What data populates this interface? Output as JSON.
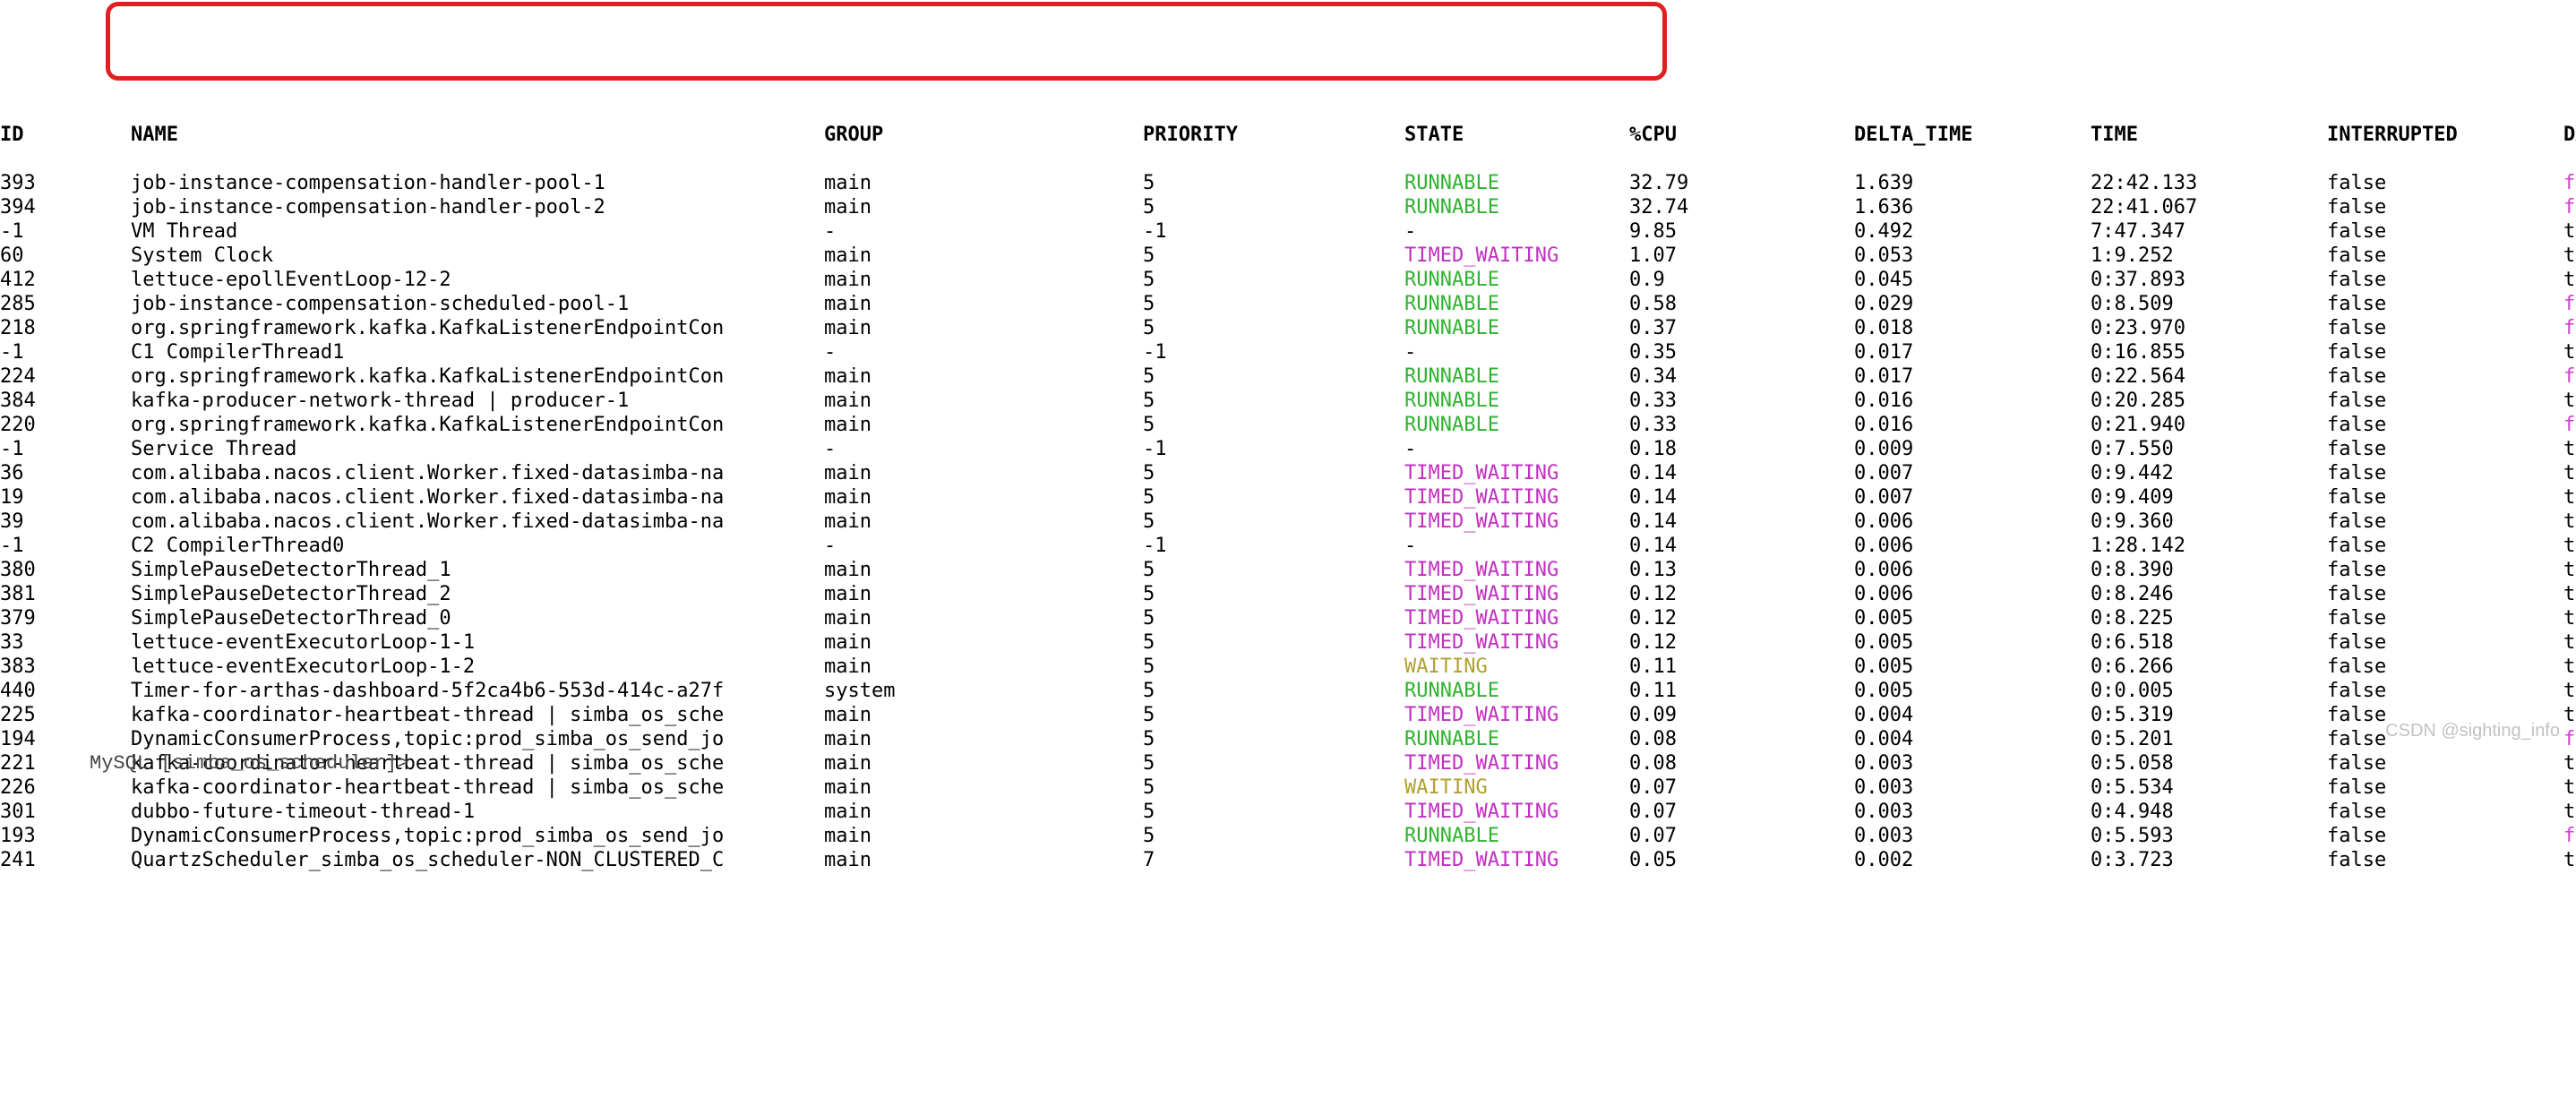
{
  "headers": {
    "id": "ID",
    "name": "NAME",
    "group": "GROUP",
    "priority": "PRIORITY",
    "state": "STATE",
    "cpu": "%CPU",
    "delta": "DELTA_TIME",
    "time": "TIME",
    "interrupted": "INTERRUPTED",
    "daemon": "DAEMON"
  },
  "rows": [
    {
      "id": "393",
      "name": "job-instance-compensation-handler-pool-1",
      "group": "main",
      "priority": "5",
      "state": "RUNNABLE",
      "cpu": "32.79",
      "delta": "1.639",
      "time": "22:42.133",
      "interrupted": "false",
      "daemon": "false"
    },
    {
      "id": "394",
      "name": "job-instance-compensation-handler-pool-2",
      "group": "main",
      "priority": "5",
      "state": "RUNNABLE",
      "cpu": "32.74",
      "delta": "1.636",
      "time": "22:41.067",
      "interrupted": "false",
      "daemon": "false"
    },
    {
      "id": "-1",
      "name": "VM Thread",
      "group": "-",
      "priority": "-1",
      "state": "-",
      "cpu": "9.85",
      "delta": "0.492",
      "time": "7:47.347",
      "interrupted": "false",
      "daemon": "true"
    },
    {
      "id": "60",
      "name": "System Clock",
      "group": "main",
      "priority": "5",
      "state": "TIMED_WAITING",
      "cpu": "1.07",
      "delta": "0.053",
      "time": "1:9.252",
      "interrupted": "false",
      "daemon": "true"
    },
    {
      "id": "412",
      "name": "lettuce-epollEventLoop-12-2",
      "group": "main",
      "priority": "5",
      "state": "RUNNABLE",
      "cpu": "0.9",
      "delta": "0.045",
      "time": "0:37.893",
      "interrupted": "false",
      "daemon": "true"
    },
    {
      "id": "285",
      "name": "job-instance-compensation-scheduled-pool-1",
      "group": "main",
      "priority": "5",
      "state": "RUNNABLE",
      "cpu": "0.58",
      "delta": "0.029",
      "time": "0:8.509",
      "interrupted": "false",
      "daemon": "false"
    },
    {
      "id": "218",
      "name": "org.springframework.kafka.KafkaListenerEndpointCon",
      "group": "main",
      "priority": "5",
      "state": "RUNNABLE",
      "cpu": "0.37",
      "delta": "0.018",
      "time": "0:23.970",
      "interrupted": "false",
      "daemon": "false"
    },
    {
      "id": "-1",
      "name": "C1 CompilerThread1",
      "group": "-",
      "priority": "-1",
      "state": "-",
      "cpu": "0.35",
      "delta": "0.017",
      "time": "0:16.855",
      "interrupted": "false",
      "daemon": "true"
    },
    {
      "id": "224",
      "name": "org.springframework.kafka.KafkaListenerEndpointCon",
      "group": "main",
      "priority": "5",
      "state": "RUNNABLE",
      "cpu": "0.34",
      "delta": "0.017",
      "time": "0:22.564",
      "interrupted": "false",
      "daemon": "false"
    },
    {
      "id": "384",
      "name": "kafka-producer-network-thread | producer-1",
      "group": "main",
      "priority": "5",
      "state": "RUNNABLE",
      "cpu": "0.33",
      "delta": "0.016",
      "time": "0:20.285",
      "interrupted": "false",
      "daemon": "true"
    },
    {
      "id": "220",
      "name": "org.springframework.kafka.KafkaListenerEndpointCon",
      "group": "main",
      "priority": "5",
      "state": "RUNNABLE",
      "cpu": "0.33",
      "delta": "0.016",
      "time": "0:21.940",
      "interrupted": "false",
      "daemon": "false"
    },
    {
      "id": "-1",
      "name": "Service Thread",
      "group": "-",
      "priority": "-1",
      "state": "-",
      "cpu": "0.18",
      "delta": "0.009",
      "time": "0:7.550",
      "interrupted": "false",
      "daemon": "true"
    },
    {
      "id": "36",
      "name": "com.alibaba.nacos.client.Worker.fixed-datasimba-na",
      "group": "main",
      "priority": "5",
      "state": "TIMED_WAITING",
      "cpu": "0.14",
      "delta": "0.007",
      "time": "0:9.442",
      "interrupted": "false",
      "daemon": "true"
    },
    {
      "id": "19",
      "name": "com.alibaba.nacos.client.Worker.fixed-datasimba-na",
      "group": "main",
      "priority": "5",
      "state": "TIMED_WAITING",
      "cpu": "0.14",
      "delta": "0.007",
      "time": "0:9.409",
      "interrupted": "false",
      "daemon": "true"
    },
    {
      "id": "39",
      "name": "com.alibaba.nacos.client.Worker.fixed-datasimba-na",
      "group": "main",
      "priority": "5",
      "state": "TIMED_WAITING",
      "cpu": "0.14",
      "delta": "0.006",
      "time": "0:9.360",
      "interrupted": "false",
      "daemon": "true"
    },
    {
      "id": "-1",
      "name": "C2 CompilerThread0",
      "group": "-",
      "priority": "-1",
      "state": "-",
      "cpu": "0.14",
      "delta": "0.006",
      "time": "1:28.142",
      "interrupted": "false",
      "daemon": "true"
    },
    {
      "id": "380",
      "name": "SimplePauseDetectorThread_1",
      "group": "main",
      "priority": "5",
      "state": "TIMED_WAITING",
      "cpu": "0.13",
      "delta": "0.006",
      "time": "0:8.390",
      "interrupted": "false",
      "daemon": "true"
    },
    {
      "id": "381",
      "name": "SimplePauseDetectorThread_2",
      "group": "main",
      "priority": "5",
      "state": "TIMED_WAITING",
      "cpu": "0.12",
      "delta": "0.006",
      "time": "0:8.246",
      "interrupted": "false",
      "daemon": "true"
    },
    {
      "id": "379",
      "name": "SimplePauseDetectorThread_0",
      "group": "main",
      "priority": "5",
      "state": "TIMED_WAITING",
      "cpu": "0.12",
      "delta": "0.005",
      "time": "0:8.225",
      "interrupted": "false",
      "daemon": "true"
    },
    {
      "id": "33",
      "name": "lettuce-eventExecutorLoop-1-1",
      "group": "main",
      "priority": "5",
      "state": "TIMED_WAITING",
      "cpu": "0.12",
      "delta": "0.005",
      "time": "0:6.518",
      "interrupted": "false",
      "daemon": "true"
    },
    {
      "id": "383",
      "name": "lettuce-eventExecutorLoop-1-2",
      "group": "main",
      "priority": "5",
      "state": "WAITING",
      "cpu": "0.11",
      "delta": "0.005",
      "time": "0:6.266",
      "interrupted": "false",
      "daemon": "true"
    },
    {
      "id": "440",
      "name": "Timer-for-arthas-dashboard-5f2ca4b6-553d-414c-a27f",
      "group": "system",
      "priority": "5",
      "state": "RUNNABLE",
      "cpu": "0.11",
      "delta": "0.005",
      "time": "0:0.005",
      "interrupted": "false",
      "daemon": "true"
    },
    {
      "id": "225",
      "name": "kafka-coordinator-heartbeat-thread | simba_os_sche",
      "group": "main",
      "priority": "5",
      "state": "TIMED_WAITING",
      "cpu": "0.09",
      "delta": "0.004",
      "time": "0:5.319",
      "interrupted": "false",
      "daemon": "true"
    },
    {
      "id": "194",
      "name": "DynamicConsumerProcess,topic:prod_simba_os_send_jo",
      "group": "main",
      "priority": "5",
      "state": "RUNNABLE",
      "cpu": "0.08",
      "delta": "0.004",
      "time": "0:5.201",
      "interrupted": "false",
      "daemon": "false"
    },
    {
      "id": "221",
      "name": "kafka-coordinator-heartbeat-thread | simba_os_sche",
      "group": "main",
      "priority": "5",
      "state": "TIMED_WAITING",
      "cpu": "0.08",
      "delta": "0.003",
      "time": "0:5.058",
      "interrupted": "false",
      "daemon": "true"
    },
    {
      "id": "226",
      "name": "kafka-coordinator-heartbeat-thread | simba_os_sche",
      "group": "main",
      "priority": "5",
      "state": "WAITING",
      "cpu": "0.07",
      "delta": "0.003",
      "time": "0:5.534",
      "interrupted": "false",
      "daemon": "true"
    },
    {
      "id": "301",
      "name": "dubbo-future-timeout-thread-1",
      "group": "main",
      "priority": "5",
      "state": "TIMED_WAITING",
      "cpu": "0.07",
      "delta": "0.003",
      "time": "0:4.948",
      "interrupted": "false",
      "daemon": "true"
    },
    {
      "id": "193",
      "name": "DynamicConsumerProcess,topic:prod_simba_os_send_jo",
      "group": "main",
      "priority": "5",
      "state": "RUNNABLE",
      "cpu": "0.07",
      "delta": "0.003",
      "time": "0:5.593",
      "interrupted": "false",
      "daemon": "false"
    },
    {
      "id": "241",
      "name": "QuartzScheduler_simba_os_scheduler-NON_CLUSTERED_C",
      "group": "main",
      "priority": "7",
      "state": "TIMED_WAITING",
      "cpu": "0.05",
      "delta": "0.002",
      "time": "0:3.723",
      "interrupted": "false",
      "daemon": "true"
    }
  ],
  "watermark": "CSDN @sighting_info",
  "footer": "MySQL [simba_os_scheduler]> "
}
